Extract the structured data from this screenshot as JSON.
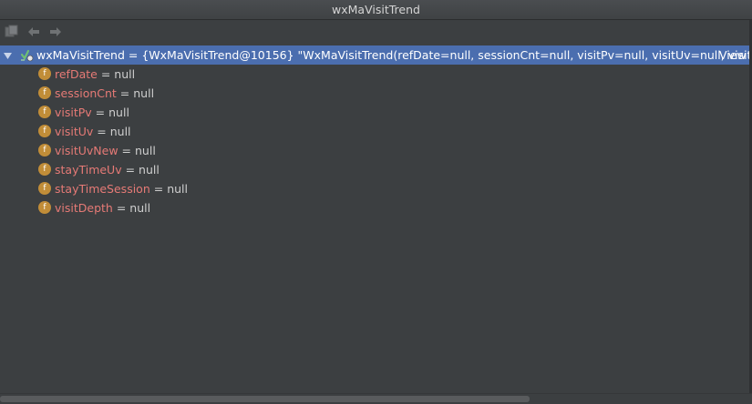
{
  "window": {
    "title": "wxMaVisitTrend"
  },
  "toolbar": {
    "buttons": [
      {
        "icon": "copy-icon",
        "enabled": false
      },
      {
        "icon": "arrow-left-icon",
        "enabled": false
      },
      {
        "icon": "arrow-right-icon",
        "enabled": false
      }
    ]
  },
  "tree": {
    "root": {
      "name": "wxMaVisitTrend",
      "equals": " = ",
      "type_ref": "{WxMaVisitTrend@10156}",
      "value_preview": " \"WxMaVisitTrend(refDate=null, sessionCnt=null, visitPv=null, visitUv=null, visitUvN...",
      "view_link": "View",
      "expanded": true,
      "selected": true
    },
    "fields": [
      {
        "name": "refDate",
        "equals": " = ",
        "value": "null"
      },
      {
        "name": "sessionCnt",
        "equals": " = ",
        "value": "null"
      },
      {
        "name": "visitPv",
        "equals": " = ",
        "value": "null"
      },
      {
        "name": "visitUv",
        "equals": " = ",
        "value": "null"
      },
      {
        "name": "visitUvNew",
        "equals": " = ",
        "value": "null"
      },
      {
        "name": "stayTimeUv",
        "equals": " = ",
        "value": "null"
      },
      {
        "name": "stayTimeSession",
        "equals": " = ",
        "value": "null"
      },
      {
        "name": "visitDepth",
        "equals": " = ",
        "value": "null"
      }
    ],
    "field_icon_letter": "f"
  },
  "colors": {
    "background": "#3c3f41",
    "selection": "#4b6eaf",
    "field_name": "#e67a76",
    "field_icon": "#c18d38"
  }
}
